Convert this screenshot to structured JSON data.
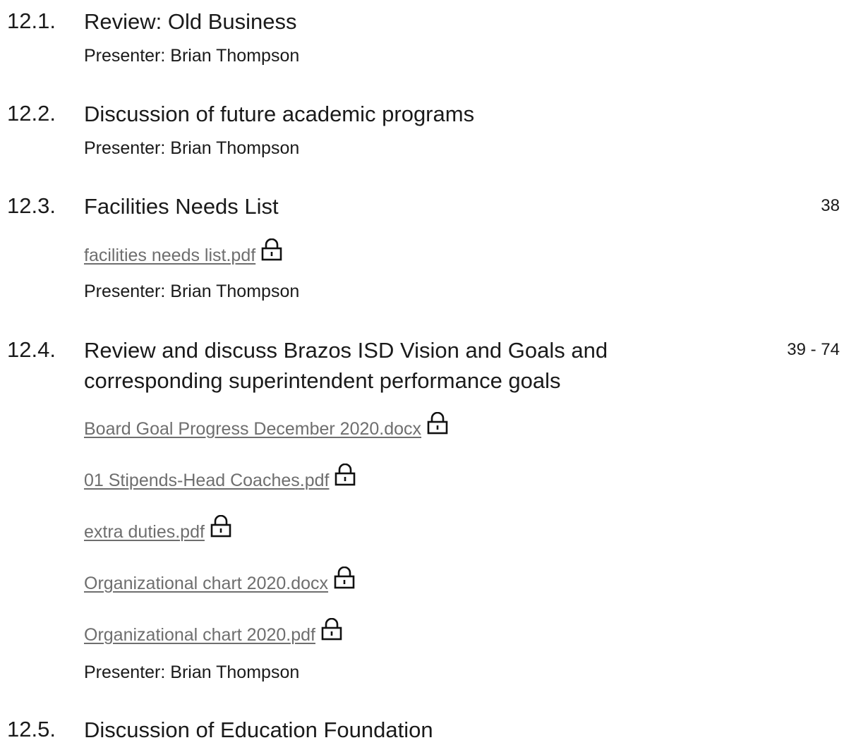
{
  "agenda": [
    {
      "number": "12.1.",
      "title": "Review: Old Business",
      "presenter": "Presenter: Brian Thompson"
    },
    {
      "number": "12.2.",
      "title": "Discussion of future academic programs",
      "presenter": "Presenter: Brian Thompson"
    },
    {
      "number": "12.3.",
      "title": "Facilities Needs List",
      "pages": "38",
      "attachments": [
        {
          "label": "facilities needs list.pdf",
          "icon": "lock-icon"
        }
      ],
      "presenter": "Presenter: Brian Thompson"
    },
    {
      "number": "12.4.",
      "title_line1": "Review and discuss Brazos ISD Vision and Goals and",
      "title_line2": "corresponding superintendent performance goals",
      "pages": "39 - 74",
      "attachments": [
        {
          "label": "Board Goal Progress December 2020.docx",
          "icon": "lock-icon"
        },
        {
          "label": "01 Stipends-Head Coaches.pdf",
          "icon": "lock-icon"
        },
        {
          "label": "extra duties.pdf",
          "icon": "lock-icon"
        },
        {
          "label": "Organizational chart 2020.docx",
          "icon": "lock-icon"
        },
        {
          "label": "Organizational chart 2020.pdf",
          "icon": "lock-icon"
        }
      ],
      "presenter": "Presenter: Brian Thompson"
    },
    {
      "number": "12.5.",
      "title": "Discussion of Education Foundation"
    }
  ],
  "colors": {
    "text": "#1a1a1a",
    "link": "#6e6e6e"
  }
}
